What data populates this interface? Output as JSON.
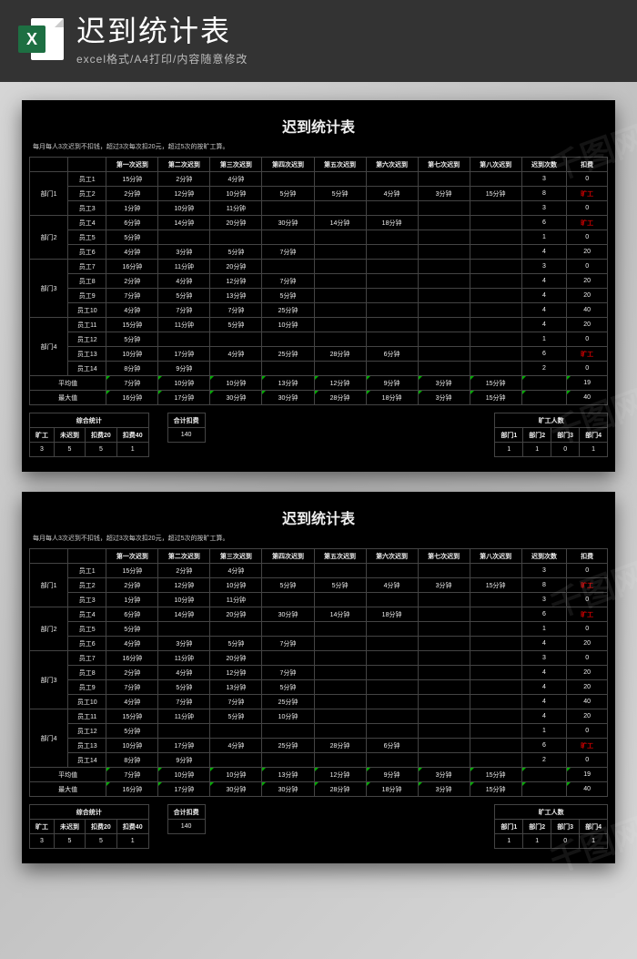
{
  "header": {
    "title": "迟到统计表",
    "subtitle": "excel格式/A4打印/内容随意修改",
    "icon_letter": "X"
  },
  "sheet": {
    "title": "迟到统计表",
    "note": "每月每人3次迟到不扣钱，超过3次每次扣20元，超过5次的按旷工算。",
    "columns": [
      "第一次迟到",
      "第二次迟到",
      "第三次迟到",
      "第四次迟到",
      "第五次迟到",
      "第六次迟到",
      "第七次迟到",
      "第八次迟到",
      "迟到次数",
      "扣费"
    ],
    "depts": [
      {
        "name": "部门1",
        "emps": [
          {
            "name": "员工1",
            "late": [
              "15分钟",
              "2分钟",
              "4分钟",
              "",
              "",
              "",
              "",
              ""
            ],
            "count": "3",
            "fee": "0"
          },
          {
            "name": "员工2",
            "late": [
              "2分钟",
              "12分钟",
              "10分钟",
              "5分钟",
              "5分钟",
              "4分钟",
              "3分钟",
              "15分钟"
            ],
            "count": "8",
            "fee": "旷工",
            "red": true
          },
          {
            "name": "员工3",
            "late": [
              "1分钟",
              "10分钟",
              "11分钟",
              "",
              "",
              "",
              "",
              ""
            ],
            "count": "3",
            "fee": "0"
          }
        ]
      },
      {
        "name": "部门2",
        "emps": [
          {
            "name": "员工4",
            "late": [
              "6分钟",
              "14分钟",
              "20分钟",
              "30分钟",
              "14分钟",
              "18分钟",
              "",
              ""
            ],
            "count": "6",
            "fee": "旷工",
            "red": true
          },
          {
            "name": "员工5",
            "late": [
              "5分钟",
              "",
              "",
              "",
              "",
              "",
              "",
              ""
            ],
            "count": "1",
            "fee": "0"
          },
          {
            "name": "员工6",
            "late": [
              "4分钟",
              "3分钟",
              "5分钟",
              "7分钟",
              "",
              "",
              "",
              ""
            ],
            "count": "4",
            "fee": "20"
          }
        ]
      },
      {
        "name": "部门3",
        "emps": [
          {
            "name": "员工7",
            "late": [
              "16分钟",
              "11分钟",
              "20分钟",
              "",
              "",
              "",
              "",
              ""
            ],
            "count": "3",
            "fee": "0"
          },
          {
            "name": "员工8",
            "late": [
              "2分钟",
              "4分钟",
              "12分钟",
              "7分钟",
              "",
              "",
              "",
              ""
            ],
            "count": "4",
            "fee": "20"
          },
          {
            "name": "员工9",
            "late": [
              "7分钟",
              "5分钟",
              "13分钟",
              "5分钟",
              "",
              "",
              "",
              ""
            ],
            "count": "4",
            "fee": "20"
          },
          {
            "name": "员工10",
            "late": [
              "4分钟",
              "7分钟",
              "7分钟",
              "25分钟",
              "",
              "",
              "",
              ""
            ],
            "count": "4",
            "fee": "40"
          }
        ]
      },
      {
        "name": "部门4",
        "emps": [
          {
            "name": "员工11",
            "late": [
              "15分钟",
              "11分钟",
              "5分钟",
              "10分钟",
              "",
              "",
              "",
              ""
            ],
            "count": "4",
            "fee": "20"
          },
          {
            "name": "员工12",
            "late": [
              "5分钟",
              "",
              "",
              "",
              "",
              "",
              "",
              ""
            ],
            "count": "1",
            "fee": "0"
          },
          {
            "name": "员工13",
            "late": [
              "10分钟",
              "17分钟",
              "4分钟",
              "25分钟",
              "28分钟",
              "6分钟",
              "",
              ""
            ],
            "count": "6",
            "fee": "旷工",
            "red": true
          },
          {
            "name": "员工14",
            "late": [
              "8分钟",
              "9分钟",
              "",
              "",
              "",
              "",
              "",
              ""
            ],
            "count": "2",
            "fee": "0"
          }
        ]
      }
    ],
    "avg_label": "平均值",
    "avg": [
      "7分钟",
      "10分钟",
      "10分钟",
      "13分钟",
      "12分钟",
      "9分钟",
      "3分钟",
      "15分钟",
      "",
      "19"
    ],
    "max_label": "最大值",
    "max": [
      "16分钟",
      "17分钟",
      "30分钟",
      "30分钟",
      "28分钟",
      "18分钟",
      "3分钟",
      "15分钟",
      "",
      "40"
    ]
  },
  "summary": {
    "title": "综合统计",
    "headers": [
      "旷工",
      "未迟到",
      "扣费20",
      "扣费40"
    ],
    "values": [
      "3",
      "5",
      "5",
      "1"
    ]
  },
  "total_fee": {
    "label": "合计扣费",
    "value": "140"
  },
  "dept_summary": {
    "title": "旷工人数",
    "headers": [
      "部门1",
      "部门2",
      "部门3",
      "部门4"
    ],
    "values": [
      "1",
      "1",
      "0",
      "1"
    ]
  },
  "watermark": "千图网"
}
